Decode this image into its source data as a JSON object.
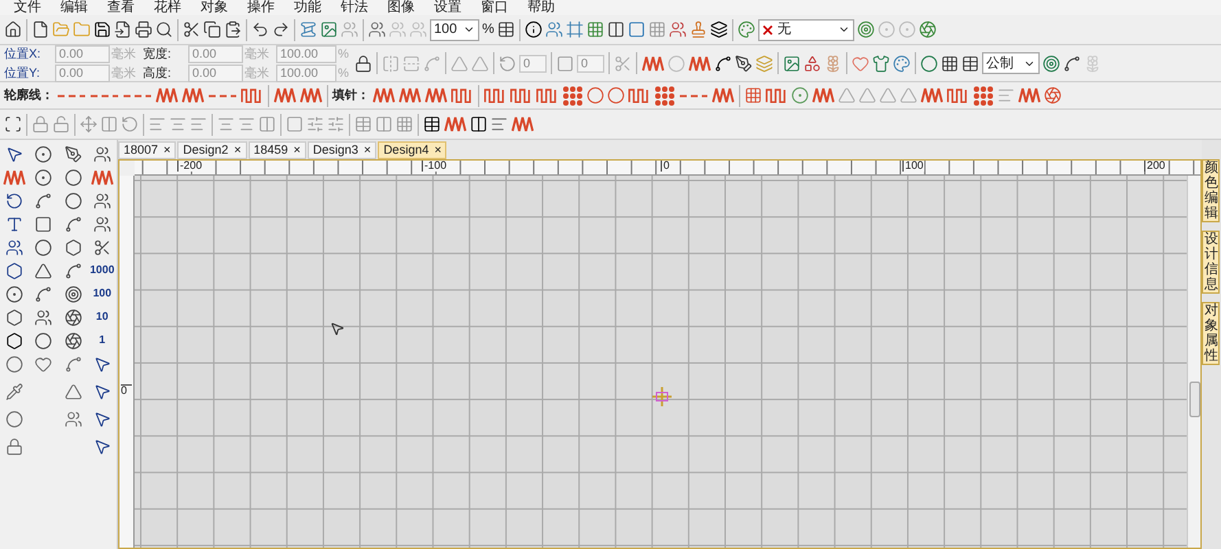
{
  "menu": [
    "文件",
    "编辑",
    "查看",
    "花样",
    "对象",
    "操作",
    "功能",
    "针法",
    "图像",
    "设置",
    "窗口",
    "帮助"
  ],
  "zoom": {
    "value": "100",
    "unit": "%"
  },
  "thread_select": {
    "value": "无"
  },
  "transform_rows": [
    {
      "pos_label": "位置X:",
      "pos_value": "0.00",
      "pos_unit": "毫米",
      "size_label": "宽度:",
      "size_value": "0.00",
      "size_unit": "毫米",
      "scale_value": "100.00",
      "scale_unit": "%"
    },
    {
      "pos_label": "位置Y:",
      "pos_value": "0.00",
      "pos_unit": "毫米",
      "size_label": "高度:",
      "size_value": "0.00",
      "size_unit": "毫米",
      "scale_value": "100.00",
      "scale_unit": "%"
    }
  ],
  "rotate_value": "0",
  "slant_value": "0",
  "units_select": {
    "value": "公制"
  },
  "outline_label": "轮廓线：",
  "fill_label": "填针：",
  "tabs": [
    {
      "label": "18007",
      "close": "×",
      "selected": false
    },
    {
      "label": "Design2",
      "close": "×",
      "selected": false
    },
    {
      "label": "18459",
      "close": "×",
      "selected": false
    },
    {
      "label": "Design3",
      "close": "×",
      "selected": false
    },
    {
      "label": "Design4",
      "close": "×",
      "selected": true
    }
  ],
  "ruler": {
    "h_labels": [
      "-200",
      "-100",
      "0",
      "100",
      "200"
    ],
    "v_labels": [
      "0"
    ]
  },
  "step_labels": [
    "1000",
    "100",
    "10",
    "1"
  ],
  "side_panels": [
    {
      "label": "颜色编辑"
    },
    {
      "label": "设计信息"
    },
    {
      "label": "对象属性"
    }
  ]
}
